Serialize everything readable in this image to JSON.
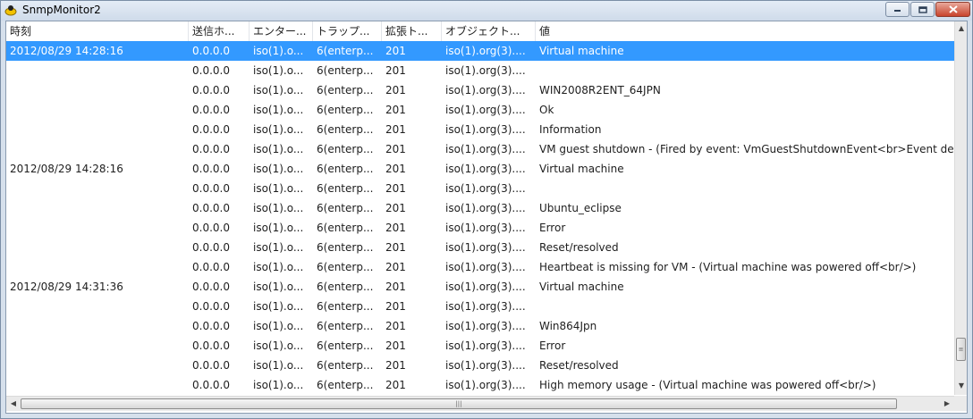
{
  "window": {
    "title": "SnmpMonitor2",
    "minimize_icon": "minimize-icon",
    "maximize_icon": "maximize-icon",
    "close_icon": "close-icon"
  },
  "columns": [
    "時刻",
    "送信ホ...",
    "エンター...",
    "トラップ...",
    "拡張ト...",
    "オブジェクト...",
    "値"
  ],
  "rows": [
    {
      "time": "2012/08/29 14:28:16",
      "sender": "0.0.0.0",
      "enterprise": "iso(1).o...",
      "trap": "6(enterp...",
      "ext": "201",
      "object": "iso(1).org(3)....",
      "value": "Virtual machine",
      "selected": true
    },
    {
      "time": "",
      "sender": "0.0.0.0",
      "enterprise": "iso(1).o...",
      "trap": "6(enterp...",
      "ext": "201",
      "object": "iso(1).org(3)....",
      "value": ""
    },
    {
      "time": "",
      "sender": "0.0.0.0",
      "enterprise": "iso(1).o...",
      "trap": "6(enterp...",
      "ext": "201",
      "object": "iso(1).org(3)....",
      "value": "WIN2008R2ENT_64JPN"
    },
    {
      "time": "",
      "sender": "0.0.0.0",
      "enterprise": "iso(1).o...",
      "trap": "6(enterp...",
      "ext": "201",
      "object": "iso(1).org(3)....",
      "value": "Ok"
    },
    {
      "time": "",
      "sender": "0.0.0.0",
      "enterprise": "iso(1).o...",
      "trap": "6(enterp...",
      "ext": "201",
      "object": "iso(1).org(3)....",
      "value": "Information"
    },
    {
      "time": "",
      "sender": "0.0.0.0",
      "enterprise": "iso(1).o...",
      "trap": "6(enterp...",
      "ext": "201",
      "object": "iso(1).org(3)....",
      "value": "VM guest shutdown - (Fired by event: VmGuestShutdownEvent<br>Event desc"
    },
    {
      "time": "2012/08/29 14:28:16",
      "sender": "0.0.0.0",
      "enterprise": "iso(1).o...",
      "trap": "6(enterp...",
      "ext": "201",
      "object": "iso(1).org(3)....",
      "value": "Virtual machine"
    },
    {
      "time": "",
      "sender": "0.0.0.0",
      "enterprise": "iso(1).o...",
      "trap": "6(enterp...",
      "ext": "201",
      "object": "iso(1).org(3)....",
      "value": ""
    },
    {
      "time": "",
      "sender": "0.0.0.0",
      "enterprise": "iso(1).o...",
      "trap": "6(enterp...",
      "ext": "201",
      "object": "iso(1).org(3)....",
      "value": "Ubuntu_eclipse"
    },
    {
      "time": "",
      "sender": "0.0.0.0",
      "enterprise": "iso(1).o...",
      "trap": "6(enterp...",
      "ext": "201",
      "object": "iso(1).org(3)....",
      "value": "Error"
    },
    {
      "time": "",
      "sender": "0.0.0.0",
      "enterprise": "iso(1).o...",
      "trap": "6(enterp...",
      "ext": "201",
      "object": "iso(1).org(3)....",
      "value": "Reset/resolved"
    },
    {
      "time": "",
      "sender": "0.0.0.0",
      "enterprise": "iso(1).o...",
      "trap": "6(enterp...",
      "ext": "201",
      "object": "iso(1).org(3)....",
      "value": "Heartbeat is missing for VM - (Virtual machine was powered off<br/>)"
    },
    {
      "time": "2012/08/29 14:31:36",
      "sender": "0.0.0.0",
      "enterprise": "iso(1).o...",
      "trap": "6(enterp...",
      "ext": "201",
      "object": "iso(1).org(3)....",
      "value": "Virtual machine"
    },
    {
      "time": "",
      "sender": "0.0.0.0",
      "enterprise": "iso(1).o...",
      "trap": "6(enterp...",
      "ext": "201",
      "object": "iso(1).org(3)....",
      "value": ""
    },
    {
      "time": "",
      "sender": "0.0.0.0",
      "enterprise": "iso(1).o...",
      "trap": "6(enterp...",
      "ext": "201",
      "object": "iso(1).org(3)....",
      "value": "Win864Jpn"
    },
    {
      "time": "",
      "sender": "0.0.0.0",
      "enterprise": "iso(1).o...",
      "trap": "6(enterp...",
      "ext": "201",
      "object": "iso(1).org(3)....",
      "value": "Error"
    },
    {
      "time": "",
      "sender": "0.0.0.0",
      "enterprise": "iso(1).o...",
      "trap": "6(enterp...",
      "ext": "201",
      "object": "iso(1).org(3)....",
      "value": "Reset/resolved"
    },
    {
      "time": "",
      "sender": "0.0.0.0",
      "enterprise": "iso(1).o...",
      "trap": "6(enterp...",
      "ext": "201",
      "object": "iso(1).org(3)....",
      "value": "High memory usage - (Virtual machine was powered off<br/>)"
    }
  ],
  "colors": {
    "selection": "#3399ff",
    "window_frame": "#d6e0ec"
  }
}
